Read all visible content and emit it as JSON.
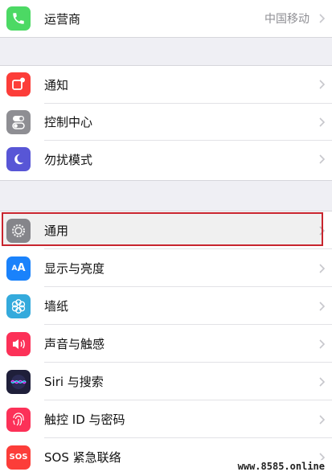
{
  "settings": {
    "carrier": {
      "label": "运营商",
      "value": "中国移动",
      "icon": "phone-icon",
      "color": "#4cd964"
    },
    "notifications": {
      "label": "通知",
      "icon": "notifications-icon",
      "color": "#fc3d39"
    },
    "control_center": {
      "label": "控制中心",
      "icon": "switches-icon",
      "color": "#8e8e93"
    },
    "do_not_disturb": {
      "label": "勿扰模式",
      "icon": "moon-icon",
      "color": "#5856d6"
    },
    "general": {
      "label": "通用",
      "icon": "gear-icon",
      "color": "#8e8e93",
      "highlighted": true
    },
    "display": {
      "label": "显示与亮度",
      "icon": "text-size-icon",
      "color": "#1a82fb"
    },
    "wallpaper": {
      "label": "墙纸",
      "icon": "flower-icon",
      "color": "#34aadc"
    },
    "sounds": {
      "label": "声音与触感",
      "icon": "speaker-icon",
      "color": "#fc3158"
    },
    "siri": {
      "label": "Siri 与搜索",
      "icon": "siri-icon",
      "color": "#1f1f3a"
    },
    "touch_id": {
      "label": "触控 ID 与密码",
      "icon": "fingerprint-icon",
      "color": "#fc3158"
    },
    "sos": {
      "label": "SOS 紧急联络",
      "icon": "sos-icon",
      "icon_text": "SOS",
      "color": "#fc3d39"
    }
  },
  "watermark": "www.8585.online"
}
